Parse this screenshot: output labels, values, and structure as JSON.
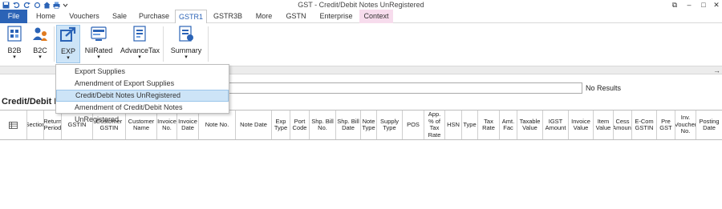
{
  "window": {
    "title": "GST - Credit/Debit Notes UnRegistered"
  },
  "quick_access": [
    "floppy-icon",
    "undo-icon",
    "redo-icon",
    "refresh-icon",
    "home-icon",
    "printer-icon",
    "chevron-down-icon"
  ],
  "tabs": [
    {
      "label": "File"
    },
    {
      "label": "Home"
    },
    {
      "label": "Vouchers"
    },
    {
      "label": "Sale"
    },
    {
      "label": "Purchase"
    },
    {
      "label": "GSTR1"
    },
    {
      "label": "GSTR3B"
    },
    {
      "label": "More"
    },
    {
      "label": "GSTN"
    },
    {
      "label": "Enterprise"
    },
    {
      "label": "Context"
    }
  ],
  "active_tab": "GSTR1",
  "ribbon": {
    "b2b": {
      "label": "B2B"
    },
    "b2c": {
      "label": "B2C"
    },
    "exp": {
      "label": "EXP"
    },
    "nilrated": {
      "label": "NilRated"
    },
    "advancetax": {
      "label": "AdvanceTax"
    },
    "summary": {
      "label": "Summary"
    }
  },
  "dropdown": {
    "items": [
      {
        "label": "Export Supplies"
      },
      {
        "label": "Amendment of Export Supplies"
      },
      {
        "label": "Credit/Debit Notes UnRegistered"
      },
      {
        "label": "Amendment of Credit/Debit Notes UnRegistered"
      }
    ],
    "highlighted_index": 2
  },
  "search": {
    "value": "",
    "results_text": "No Results"
  },
  "section_title": "Credit/Debit N",
  "grid": {
    "columns": [
      "",
      "Section",
      "Return Period",
      "GSTIN",
      "Customer GSTIN",
      "Customer Name",
      "Invoice No.",
      "Invoice Date",
      "Note No.",
      "Note Date",
      "Exp Type",
      "Port Code",
      "Shp. Bill No.",
      "Shp. Bill Date",
      "Note Type",
      "Supply Type",
      "POS",
      "App. % of Tax Rate",
      "HSN",
      "Type",
      "Tax Rate",
      "Amt. Fac",
      "Taxable Value",
      "IGST Amount",
      "Invoice Value",
      "Item Value",
      "Cess Amount",
      "E-Com GSTIN",
      "Pre GST",
      "Inv. Voucher No.",
      "Posting Date"
    ]
  },
  "colors": {
    "file_tab": "#2b63b6",
    "context_tab": "#f7dced",
    "selection": "#cde4f7"
  }
}
